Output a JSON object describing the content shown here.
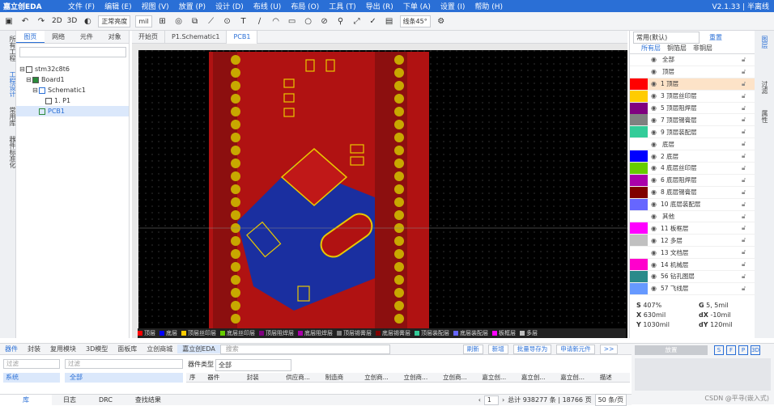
{
  "app": {
    "logo": "嘉立创EDA",
    "version": "V2.1.33 | 半离线"
  },
  "menu": [
    "文件 (F)",
    "编辑 (E)",
    "视图 (V)",
    "放置 (P)",
    "设计 (D)",
    "布线 (U)",
    "布局 (O)",
    "工具 (T)",
    "导出 (R)",
    "下单 (A)",
    "设置 (I)",
    "帮助 (H)"
  ],
  "toolbar": {
    "view2d": "2D",
    "view3d": "3D",
    "brightness": "正常亮度",
    "unit": "mil",
    "line_angle": "线条45°"
  },
  "left_vtabs": [
    "所有工程",
    "工程设计",
    "常用库",
    "器件标准化"
  ],
  "left_tabs": [
    "图页",
    "网络",
    "元件",
    "对象"
  ],
  "tree": [
    "stm32c8t6",
    "Board1",
    "Schematic1",
    "1. P1",
    "PCB1"
  ],
  "doc_tabs": [
    "开始页",
    "P1.Schematic1",
    "PCB1"
  ],
  "layer_bar": [
    {
      "name": "顶层",
      "color": "#ff0000"
    },
    {
      "name": "底层",
      "color": "#0000ff"
    },
    {
      "name": "顶层丝印层",
      "color": "#ffcc00"
    },
    {
      "name": "底层丝印层",
      "color": "#66cc00"
    },
    {
      "name": "顶层阻焊层",
      "color": "#800080"
    },
    {
      "name": "底层阻焊层",
      "color": "#aa00aa"
    },
    {
      "name": "顶层锡膏层",
      "color": "#808080"
    },
    {
      "name": "底层锡膏层",
      "color": "#800000"
    },
    {
      "name": "顶层装配层",
      "color": "#33cc99"
    },
    {
      "name": "底层装配层",
      "color": "#6666ff"
    },
    {
      "name": "板框层",
      "color": "#ff00ff"
    },
    {
      "name": "多层",
      "color": "#c0c0c0"
    }
  ],
  "right_panel": {
    "preset": "常用(默认)",
    "button": "重置",
    "tabs": [
      "所有层",
      "铜箔层",
      "非铜层"
    ],
    "layers": [
      {
        "name": "全部",
        "color": "",
        "group": true
      },
      {
        "name": "顶层",
        "color": "",
        "group": true
      },
      {
        "name": "1 顶层",
        "color": "#ff0000"
      },
      {
        "name": "3 顶层丝印层",
        "color": "#ffcc00"
      },
      {
        "name": "5 顶层阻焊层",
        "color": "#800080"
      },
      {
        "name": "7 顶层锡膏层",
        "color": "#808080"
      },
      {
        "name": "9 顶层装配层",
        "color": "#33cc99"
      },
      {
        "name": "底层",
        "color": "",
        "group": true
      },
      {
        "name": "2 底层",
        "color": "#0000ff"
      },
      {
        "name": "4 底层丝印层",
        "color": "#66cc00"
      },
      {
        "name": "6 底层阻焊层",
        "color": "#aa00aa"
      },
      {
        "name": "8 底层锡膏层",
        "color": "#800000"
      },
      {
        "name": "10 底层装配层",
        "color": "#6666ff"
      },
      {
        "name": "其他",
        "color": "",
        "group": true
      },
      {
        "name": "11 板框层",
        "color": "#ff00ff"
      },
      {
        "name": "12 多层",
        "color": "#c0c0c0"
      },
      {
        "name": "13 文档层",
        "color": "#ffffff"
      },
      {
        "name": "14 机械层",
        "color": "#ff00cc"
      },
      {
        "name": "56 钻孔图层",
        "color": "#2a8a8a"
      },
      {
        "name": "57 飞线层",
        "color": "#6699ff"
      }
    ],
    "props": [
      [
        "S",
        "407%",
        "G",
        "5, 5mil"
      ],
      [
        "X",
        "630mil",
        "dX",
        "-10mil"
      ],
      [
        "Y",
        "1030mil",
        "dY",
        "120mil"
      ]
    ]
  },
  "far_right_tabs": [
    "图层",
    "过滤",
    "属性"
  ],
  "bottom": {
    "tabs": [
      "器件",
      "封装",
      "复用模块",
      "3D模型",
      "面板库",
      "立创商城",
      "嘉立创EDA",
      "搜索"
    ],
    "buttons": [
      "刷新",
      "新增",
      "批量导存为",
      "申请新元件",
      ">>"
    ],
    "filter_placeholder": "过滤",
    "search_placeholder": "过滤",
    "cat_label": "器件类型",
    "cat_value": "全部",
    "columns": [
      "序",
      "器件",
      "封装",
      "供应商...",
      "制造商",
      "立创商...",
      "立创商...",
      "立创商...",
      "嘉立创...",
      "嘉立创...",
      "嘉立创...",
      "描述"
    ],
    "left_list": [
      "系统"
    ],
    "all_item": "全部",
    "status_tabs": [
      "库",
      "日志",
      "DRC",
      "查找结果"
    ],
    "page": "1",
    "total": "总计 938277 条 | 18766 页",
    "per_page": "50 条/页"
  },
  "bottom_right": {
    "place_button": "放置",
    "letters": [
      "S",
      "F",
      "P",
      "3D"
    ],
    "watermark": "CSDN @平寻(嵌入式)"
  }
}
